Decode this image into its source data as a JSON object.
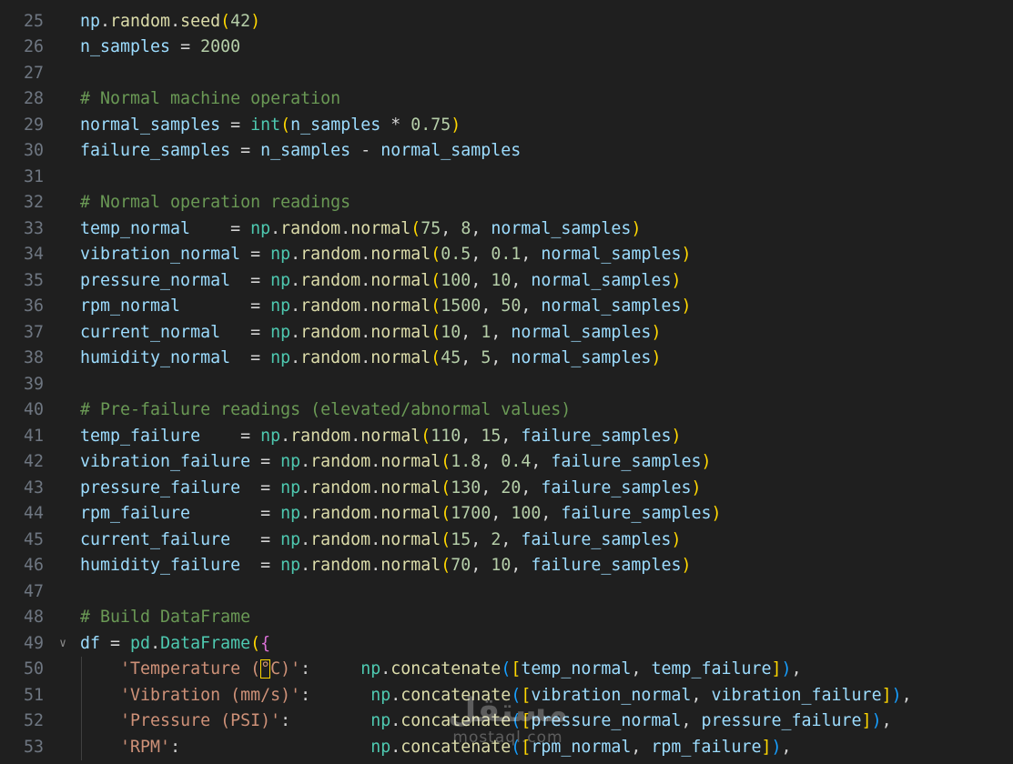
{
  "editor": {
    "language": "python",
    "lines": [
      {
        "num": "25",
        "tokens": [
          [
            "var",
            "np"
          ],
          [
            "op",
            "."
          ],
          [
            "fn",
            "random"
          ],
          [
            "op",
            "."
          ],
          [
            "fn",
            "seed"
          ],
          [
            "p1",
            "("
          ],
          [
            "num",
            "42"
          ],
          [
            "p1",
            ")"
          ]
        ]
      },
      {
        "num": "26",
        "tokens": [
          [
            "var",
            "n_samples"
          ],
          [
            "op",
            " = "
          ],
          [
            "num",
            "2000"
          ]
        ]
      },
      {
        "num": "27",
        "tokens": []
      },
      {
        "num": "28",
        "tokens": [
          [
            "com",
            "# Normal machine operation"
          ]
        ]
      },
      {
        "num": "29",
        "tokens": [
          [
            "var",
            "normal_samples"
          ],
          [
            "op",
            " = "
          ],
          [
            "mod",
            "int"
          ],
          [
            "p1",
            "("
          ],
          [
            "var",
            "n_samples"
          ],
          [
            "op",
            " * "
          ],
          [
            "num",
            "0.75"
          ],
          [
            "p1",
            ")"
          ]
        ]
      },
      {
        "num": "30",
        "tokens": [
          [
            "var",
            "failure_samples"
          ],
          [
            "op",
            " = "
          ],
          [
            "var",
            "n_samples"
          ],
          [
            "op",
            " - "
          ],
          [
            "var",
            "normal_samples"
          ]
        ]
      },
      {
        "num": "31",
        "tokens": []
      },
      {
        "num": "32",
        "tokens": [
          [
            "com",
            "# Normal operation readings"
          ]
        ]
      },
      {
        "num": "33",
        "tokens": [
          [
            "var",
            "temp_normal"
          ],
          [
            "op",
            "    = "
          ],
          [
            "mod",
            "np"
          ],
          [
            "op",
            "."
          ],
          [
            "fn",
            "random"
          ],
          [
            "op",
            "."
          ],
          [
            "fn",
            "normal"
          ],
          [
            "p1",
            "("
          ],
          [
            "num",
            "75"
          ],
          [
            "op",
            ", "
          ],
          [
            "num",
            "8"
          ],
          [
            "op",
            ", "
          ],
          [
            "var",
            "normal_samples"
          ],
          [
            "p1",
            ")"
          ]
        ]
      },
      {
        "num": "34",
        "tokens": [
          [
            "var",
            "vibration_normal"
          ],
          [
            "op",
            " = "
          ],
          [
            "mod",
            "np"
          ],
          [
            "op",
            "."
          ],
          [
            "fn",
            "random"
          ],
          [
            "op",
            "."
          ],
          [
            "fn",
            "normal"
          ],
          [
            "p1",
            "("
          ],
          [
            "num",
            "0.5"
          ],
          [
            "op",
            ", "
          ],
          [
            "num",
            "0.1"
          ],
          [
            "op",
            ", "
          ],
          [
            "var",
            "normal_samples"
          ],
          [
            "p1",
            ")"
          ]
        ]
      },
      {
        "num": "35",
        "tokens": [
          [
            "var",
            "pressure_normal"
          ],
          [
            "op",
            "  = "
          ],
          [
            "mod",
            "np"
          ],
          [
            "op",
            "."
          ],
          [
            "fn",
            "random"
          ],
          [
            "op",
            "."
          ],
          [
            "fn",
            "normal"
          ],
          [
            "p1",
            "("
          ],
          [
            "num",
            "100"
          ],
          [
            "op",
            ", "
          ],
          [
            "num",
            "10"
          ],
          [
            "op",
            ", "
          ],
          [
            "var",
            "normal_samples"
          ],
          [
            "p1",
            ")"
          ]
        ]
      },
      {
        "num": "36",
        "tokens": [
          [
            "var",
            "rpm_normal"
          ],
          [
            "op",
            "       = "
          ],
          [
            "mod",
            "np"
          ],
          [
            "op",
            "."
          ],
          [
            "fn",
            "random"
          ],
          [
            "op",
            "."
          ],
          [
            "fn",
            "normal"
          ],
          [
            "p1",
            "("
          ],
          [
            "num",
            "1500"
          ],
          [
            "op",
            ", "
          ],
          [
            "num",
            "50"
          ],
          [
            "op",
            ", "
          ],
          [
            "var",
            "normal_samples"
          ],
          [
            "p1",
            ")"
          ]
        ]
      },
      {
        "num": "37",
        "tokens": [
          [
            "var",
            "current_normal"
          ],
          [
            "op",
            "   = "
          ],
          [
            "mod",
            "np"
          ],
          [
            "op",
            "."
          ],
          [
            "fn",
            "random"
          ],
          [
            "op",
            "."
          ],
          [
            "fn",
            "normal"
          ],
          [
            "p1",
            "("
          ],
          [
            "num",
            "10"
          ],
          [
            "op",
            ", "
          ],
          [
            "num",
            "1"
          ],
          [
            "op",
            ", "
          ],
          [
            "var",
            "normal_samples"
          ],
          [
            "p1",
            ")"
          ]
        ]
      },
      {
        "num": "38",
        "tokens": [
          [
            "var",
            "humidity_normal"
          ],
          [
            "op",
            "  = "
          ],
          [
            "mod",
            "np"
          ],
          [
            "op",
            "."
          ],
          [
            "fn",
            "random"
          ],
          [
            "op",
            "."
          ],
          [
            "fn",
            "normal"
          ],
          [
            "p1",
            "("
          ],
          [
            "num",
            "45"
          ],
          [
            "op",
            ", "
          ],
          [
            "num",
            "5"
          ],
          [
            "op",
            ", "
          ],
          [
            "var",
            "normal_samples"
          ],
          [
            "p1",
            ")"
          ]
        ]
      },
      {
        "num": "39",
        "tokens": []
      },
      {
        "num": "40",
        "tokens": [
          [
            "com",
            "# Pre-failure readings (elevated/abnormal values)"
          ]
        ]
      },
      {
        "num": "41",
        "tokens": [
          [
            "var",
            "temp_failure"
          ],
          [
            "op",
            "    = "
          ],
          [
            "mod",
            "np"
          ],
          [
            "op",
            "."
          ],
          [
            "fn",
            "random"
          ],
          [
            "op",
            "."
          ],
          [
            "fn",
            "normal"
          ],
          [
            "p1",
            "("
          ],
          [
            "num",
            "110"
          ],
          [
            "op",
            ", "
          ],
          [
            "num",
            "15"
          ],
          [
            "op",
            ", "
          ],
          [
            "var",
            "failure_samples"
          ],
          [
            "p1",
            ")"
          ]
        ]
      },
      {
        "num": "42",
        "tokens": [
          [
            "var",
            "vibration_failure"
          ],
          [
            "op",
            " = "
          ],
          [
            "mod",
            "np"
          ],
          [
            "op",
            "."
          ],
          [
            "fn",
            "random"
          ],
          [
            "op",
            "."
          ],
          [
            "fn",
            "normal"
          ],
          [
            "p1",
            "("
          ],
          [
            "num",
            "1.8"
          ],
          [
            "op",
            ", "
          ],
          [
            "num",
            "0.4"
          ],
          [
            "op",
            ", "
          ],
          [
            "var",
            "failure_samples"
          ],
          [
            "p1",
            ")"
          ]
        ]
      },
      {
        "num": "43",
        "tokens": [
          [
            "var",
            "pressure_failure"
          ],
          [
            "op",
            "  = "
          ],
          [
            "mod",
            "np"
          ],
          [
            "op",
            "."
          ],
          [
            "fn",
            "random"
          ],
          [
            "op",
            "."
          ],
          [
            "fn",
            "normal"
          ],
          [
            "p1",
            "("
          ],
          [
            "num",
            "130"
          ],
          [
            "op",
            ", "
          ],
          [
            "num",
            "20"
          ],
          [
            "op",
            ", "
          ],
          [
            "var",
            "failure_samples"
          ],
          [
            "p1",
            ")"
          ]
        ]
      },
      {
        "num": "44",
        "tokens": [
          [
            "var",
            "rpm_failure"
          ],
          [
            "op",
            "       = "
          ],
          [
            "mod",
            "np"
          ],
          [
            "op",
            "."
          ],
          [
            "fn",
            "random"
          ],
          [
            "op",
            "."
          ],
          [
            "fn",
            "normal"
          ],
          [
            "p1",
            "("
          ],
          [
            "num",
            "1700"
          ],
          [
            "op",
            ", "
          ],
          [
            "num",
            "100"
          ],
          [
            "op",
            ", "
          ],
          [
            "var",
            "failure_samples"
          ],
          [
            "p1",
            ")"
          ]
        ]
      },
      {
        "num": "45",
        "tokens": [
          [
            "var",
            "current_failure"
          ],
          [
            "op",
            "   = "
          ],
          [
            "mod",
            "np"
          ],
          [
            "op",
            "."
          ],
          [
            "fn",
            "random"
          ],
          [
            "op",
            "."
          ],
          [
            "fn",
            "normal"
          ],
          [
            "p1",
            "("
          ],
          [
            "num",
            "15"
          ],
          [
            "op",
            ", "
          ],
          [
            "num",
            "2"
          ],
          [
            "op",
            ", "
          ],
          [
            "var",
            "failure_samples"
          ],
          [
            "p1",
            ")"
          ]
        ]
      },
      {
        "num": "46",
        "tokens": [
          [
            "var",
            "humidity_failure"
          ],
          [
            "op",
            "  = "
          ],
          [
            "mod",
            "np"
          ],
          [
            "op",
            "."
          ],
          [
            "fn",
            "random"
          ],
          [
            "op",
            "."
          ],
          [
            "fn",
            "normal"
          ],
          [
            "p1",
            "("
          ],
          [
            "num",
            "70"
          ],
          [
            "op",
            ", "
          ],
          [
            "num",
            "10"
          ],
          [
            "op",
            ", "
          ],
          [
            "var",
            "failure_samples"
          ],
          [
            "p1",
            ")"
          ]
        ]
      },
      {
        "num": "47",
        "tokens": []
      },
      {
        "num": "48",
        "tokens": [
          [
            "com",
            "# Build DataFrame"
          ]
        ]
      },
      {
        "num": "49",
        "fold": "chevron-down-icon",
        "tokens": [
          [
            "var",
            "df"
          ],
          [
            "op",
            " = "
          ],
          [
            "mod",
            "pd"
          ],
          [
            "op",
            "."
          ],
          [
            "mod",
            "DataFrame"
          ],
          [
            "p1",
            "("
          ],
          [
            "p2",
            "{"
          ]
        ]
      },
      {
        "num": "50",
        "guide": true,
        "tokens": [
          [
            "op",
            "    "
          ],
          [
            "str",
            "'Temperature ("
          ],
          [
            "strcur",
            "°"
          ],
          [
            "str",
            "C)'"
          ],
          [
            "op",
            ":     "
          ],
          [
            "mod",
            "np"
          ],
          [
            "op",
            "."
          ],
          [
            "fn",
            "concatenate"
          ],
          [
            "p3",
            "("
          ],
          [
            "p1",
            "["
          ],
          [
            "var",
            "temp_normal"
          ],
          [
            "op",
            ", "
          ],
          [
            "var",
            "temp_failure"
          ],
          [
            "p1",
            "]"
          ],
          [
            "p3",
            ")"
          ],
          [
            "op",
            ","
          ]
        ]
      },
      {
        "num": "51",
        "guide": true,
        "tokens": [
          [
            "op",
            "    "
          ],
          [
            "str",
            "'Vibration (mm/s)'"
          ],
          [
            "op",
            ":      "
          ],
          [
            "mod",
            "np"
          ],
          [
            "op",
            "."
          ],
          [
            "fn",
            "concatenate"
          ],
          [
            "p3",
            "("
          ],
          [
            "p1",
            "["
          ],
          [
            "var",
            "vibration_normal"
          ],
          [
            "op",
            ", "
          ],
          [
            "var",
            "vibration_failure"
          ],
          [
            "p1",
            "]"
          ],
          [
            "p3",
            ")"
          ],
          [
            "op",
            ","
          ]
        ]
      },
      {
        "num": "52",
        "guide": true,
        "tokens": [
          [
            "op",
            "    "
          ],
          [
            "str",
            "'Pressure (PSI)'"
          ],
          [
            "op",
            ":        "
          ],
          [
            "mod",
            "np"
          ],
          [
            "op",
            "."
          ],
          [
            "fn",
            "concatenate"
          ],
          [
            "p3",
            "("
          ],
          [
            "p1",
            "["
          ],
          [
            "var",
            "pressure_normal"
          ],
          [
            "op",
            ", "
          ],
          [
            "var",
            "pressure_failure"
          ],
          [
            "p1",
            "]"
          ],
          [
            "p3",
            ")"
          ],
          [
            "op",
            ","
          ]
        ]
      },
      {
        "num": "53",
        "guide": true,
        "tokens": [
          [
            "op",
            "    "
          ],
          [
            "str",
            "'RPM'"
          ],
          [
            "op",
            ":                   "
          ],
          [
            "mod",
            "np"
          ],
          [
            "op",
            "."
          ],
          [
            "fn",
            "concatenate"
          ],
          [
            "p3",
            "("
          ],
          [
            "p1",
            "["
          ],
          [
            "var",
            "rpm_normal"
          ],
          [
            "op",
            ", "
          ],
          [
            "var",
            "rpm_failure"
          ],
          [
            "p1",
            "]"
          ],
          [
            "p3",
            ")"
          ],
          [
            "op",
            ","
          ]
        ]
      }
    ]
  },
  "watermark": {
    "logo_text": "مستقل",
    "site_text": "mostaql.com"
  },
  "colors": {
    "background": "#1f1f1f",
    "line_number": "#6e7681",
    "comment": "#6a9955",
    "variable": "#9cdcfe",
    "module": "#4ec9b0",
    "function": "#dcdcaa",
    "number": "#b5cea8",
    "string": "#ce9178",
    "bracket_1": "#ffd700",
    "bracket_2": "#da70d6",
    "bracket_3": "#179fff"
  }
}
